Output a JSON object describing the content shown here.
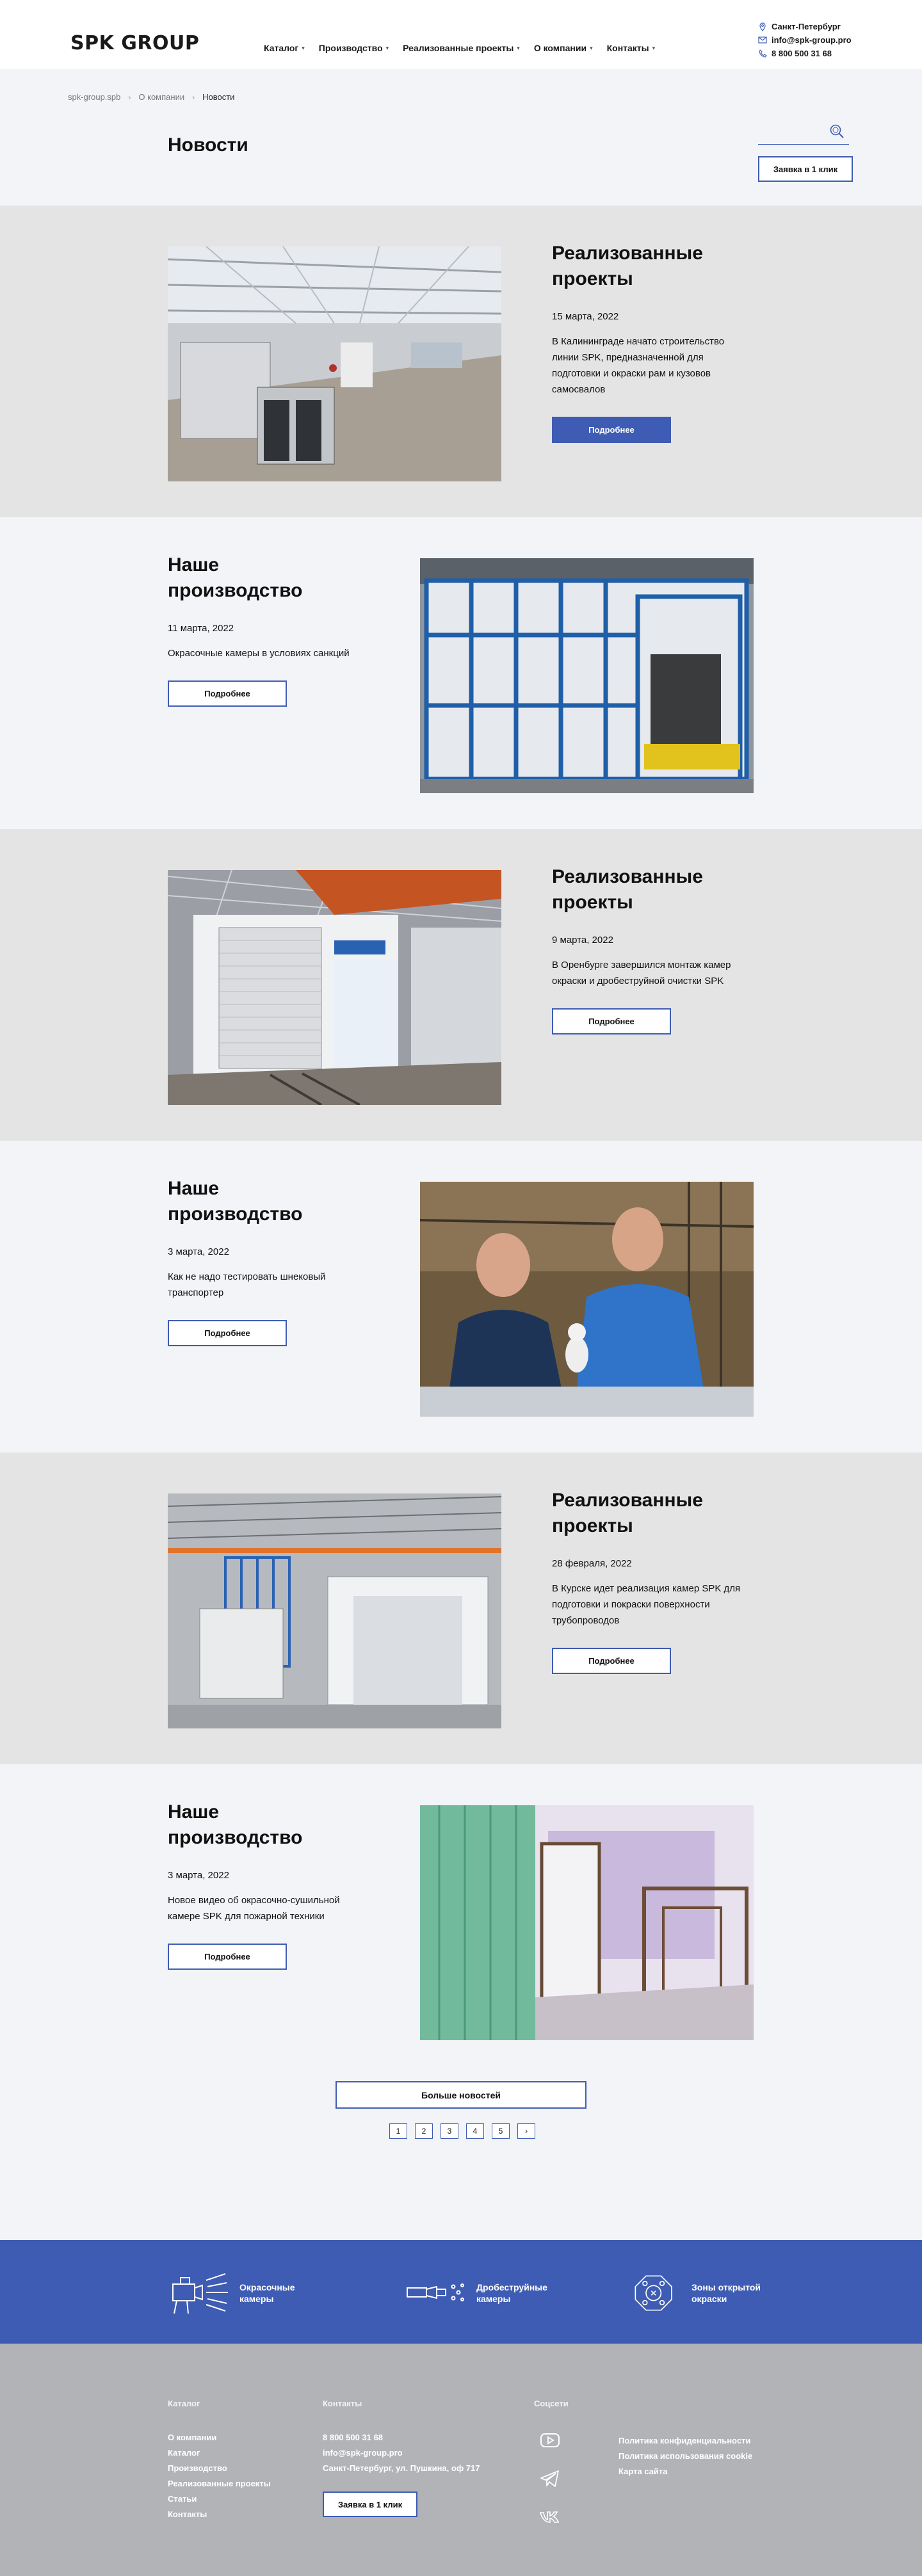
{
  "header": {
    "logo": "SPK GROUP",
    "nav": [
      "Каталог",
      "Производство",
      "Реализованные проекты",
      "О компании",
      "Контакты"
    ],
    "city": "Санкт-Петербург",
    "email": "info@spk-group.pro",
    "phone": "8 800 500 31 68"
  },
  "breadcrumb": [
    "spk-group.spb",
    "О компании",
    "Новости"
  ],
  "page_title": "Новости",
  "search_placeholder": "",
  "quick_order": "Заявка в 1 клик",
  "news": [
    {
      "category": "Реализованные проекты",
      "date": "15 марта, 2022",
      "text": "В Калининграде начато строительство линии SPK, предназначенной для подготовки и окраски рам и кузовов самосвалов",
      "button": "Подробнее"
    },
    {
      "category": "Наше производство",
      "date": "11 марта, 2022",
      "text": "Окрасочные камеры в условиях санкций",
      "button": "Подробнее"
    },
    {
      "category": "Реализованные проекты",
      "date": "9 марта, 2022",
      "text": "В Оренбурге завершился монтаж камер окраски и дробеструйной очистки SPK",
      "button": "Подробнее"
    },
    {
      "category": "Наше производство",
      "date": "3 марта, 2022",
      "text": "Как не надо тестировать шнековый транспортер",
      "button": "Подробнее"
    },
    {
      "category": "Реализованные проекты",
      "date": "28 февраля, 2022",
      "text": "В Курске идет реализация камер SPK для подготовки и покраски поверхности трубопроводов",
      "button": "Подробнее"
    },
    {
      "category": "Наше производство",
      "date": "3 марта, 2022",
      "text": "Новое видео об окрасочно-сушильной камере SPK для пожарной техники",
      "button": "Подробнее"
    }
  ],
  "load_more": "Больше новостей",
  "pages": [
    "1",
    "2",
    "3",
    "4",
    "5",
    "›"
  ],
  "categories": [
    {
      "label": "Окрасочные камеры",
      "icon": "spray-booth-icon"
    },
    {
      "label": "Дробеструйные камеры",
      "icon": "blast-gun-icon"
    },
    {
      "label": "Зоны открытой окраски",
      "icon": "open-zone-icon"
    }
  ],
  "footer": {
    "catalog_title": "Каталог",
    "catalog_links": [
      "О компании",
      "Каталог",
      "Производство",
      "Реализованные проекты",
      "Статьи",
      "Контакты"
    ],
    "contacts_title": "Контакты",
    "phone": "8 800 500 31 68",
    "email": "info@spk-group.pro",
    "address": "Санкт-Петербург, ул. Пушкина, оф 717",
    "quick_order": "Заявка в 1 клик",
    "social_title": "Соцсети",
    "policy_links": [
      "Политика конфиденциальности",
      "Политика использования cookie",
      "Карта сайта"
    ]
  },
  "colors": {
    "accent": "#3e5cb3",
    "gray_section": "#e4e4e4",
    "light_section": "#f3f4f8",
    "footer": "#b1b3b7"
  }
}
